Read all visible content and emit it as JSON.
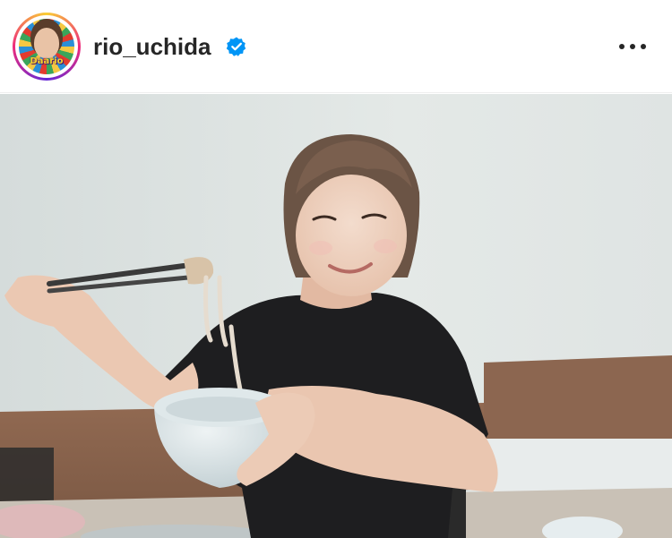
{
  "post": {
    "author": {
      "username": "rio_uchida",
      "avatar_text": "Daario",
      "verified": true,
      "verified_icon": "verified-badge-icon",
      "verified_color": "#0095f6"
    },
    "menu_icon": "more-horizontal-icon",
    "photo_icon": "post-photo"
  }
}
